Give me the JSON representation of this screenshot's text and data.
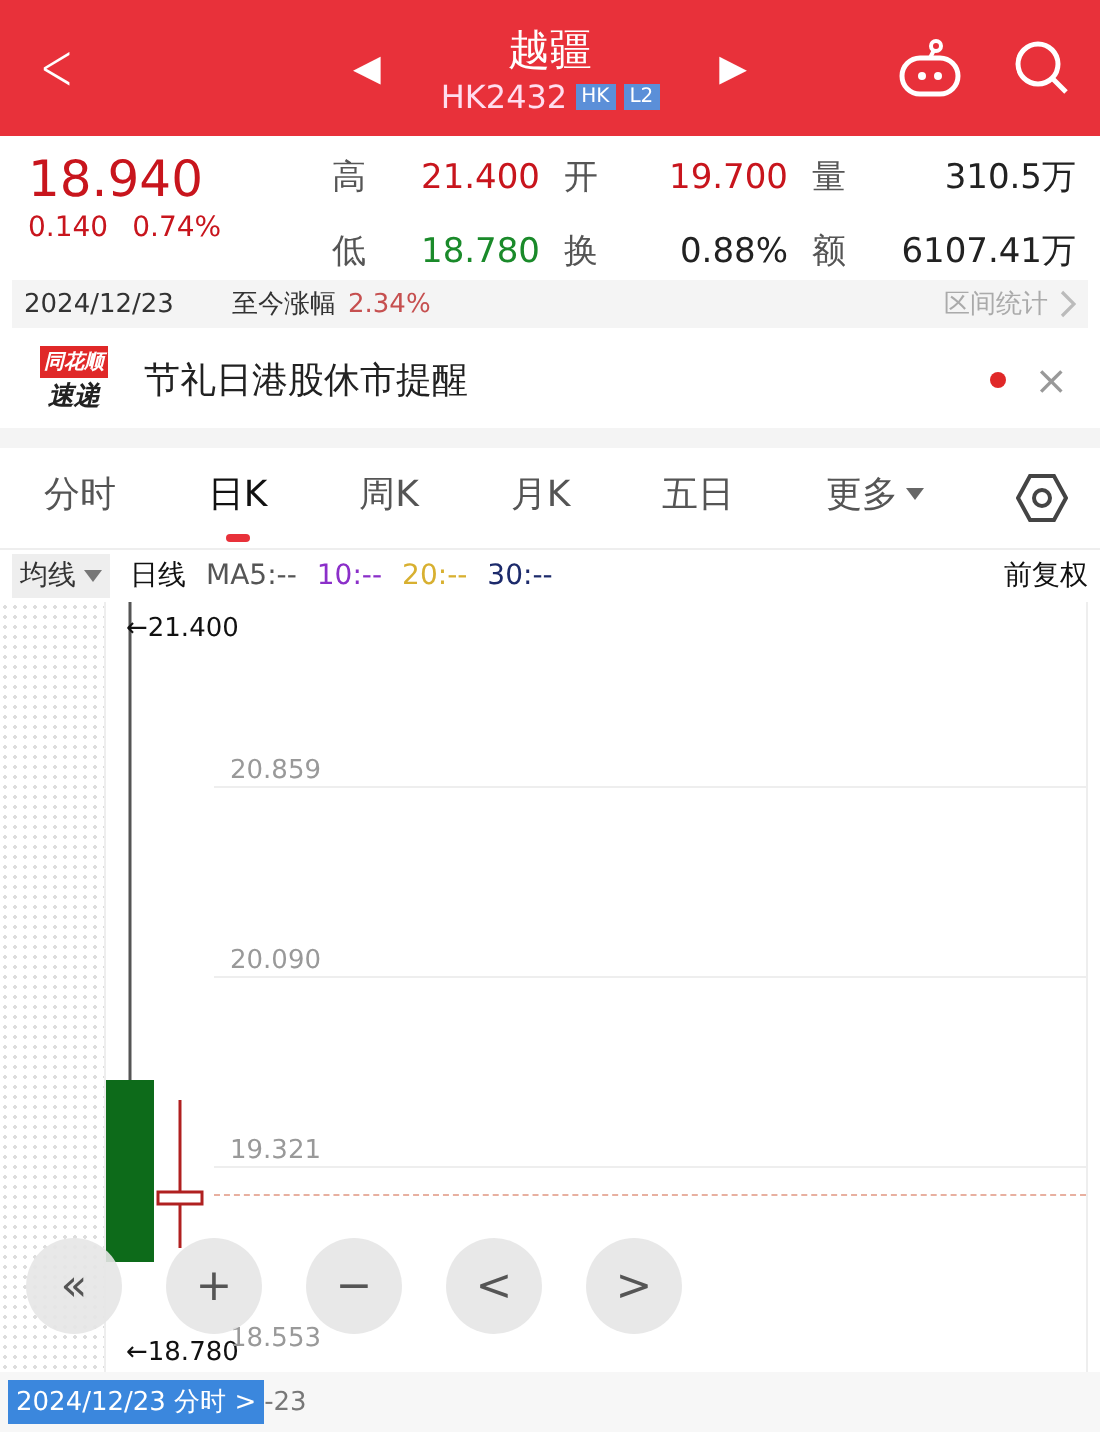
{
  "header": {
    "back": "<",
    "prev": "◀",
    "next": "▶",
    "title": "越疆",
    "code": "HK2432",
    "badges": [
      "HK",
      "L2"
    ]
  },
  "quote": {
    "price": "18.940",
    "change": "0.140",
    "change_pct": "0.74%",
    "stats": [
      {
        "label": "高",
        "value": "21.400",
        "color": "#c8151d"
      },
      {
        "label": "开",
        "value": "19.700",
        "color": "#c8151d"
      },
      {
        "label": "量",
        "value": "310.5万",
        "color": "#222222"
      },
      {
        "label": "低",
        "value": "18.780",
        "color": "#1a8a2a"
      },
      {
        "label": "换",
        "value": "0.88%",
        "color": "#222222"
      },
      {
        "label": "额",
        "value": "6107.41万",
        "color": "#222222"
      }
    ]
  },
  "range": {
    "date": "2024/12/23",
    "label": "至今涨幅",
    "value": "2.34%",
    "link": "区间统计"
  },
  "notice": {
    "logo_top": "同花顺",
    "logo_bottom": "速递",
    "text": "节礼日港股休市提醒",
    "unread": true,
    "close": "×"
  },
  "tabs": [
    {
      "label": "分时",
      "selected": false
    },
    {
      "label": "日K",
      "selected": true
    },
    {
      "label": "周K",
      "selected": false
    },
    {
      "label": "月K",
      "selected": false
    },
    {
      "label": "五日",
      "selected": false
    },
    {
      "label": "更多",
      "selected": false,
      "dropdown": true
    }
  ],
  "ma": {
    "selector": "均线",
    "type": "日线",
    "items": [
      {
        "text": "MA5:--",
        "color": "#555555"
      },
      {
        "text": "10:--",
        "color": "#8b2fc9"
      },
      {
        "text": "20:--",
        "color": "#d8b030"
      },
      {
        "text": "30:--",
        "color": "#1c2a6b"
      }
    ],
    "adjust": "前复权"
  },
  "chart": {
    "axis_labels": [
      "20.859",
      "20.090",
      "19.321",
      "18.553"
    ],
    "high_marker": "←21.400",
    "low_marker": "←18.780",
    "controls": [
      "«",
      "+",
      "−",
      "<",
      ">"
    ]
  },
  "footer": {
    "date_tag": "2024/12/23 分时 >",
    "date": "-23"
  }
}
